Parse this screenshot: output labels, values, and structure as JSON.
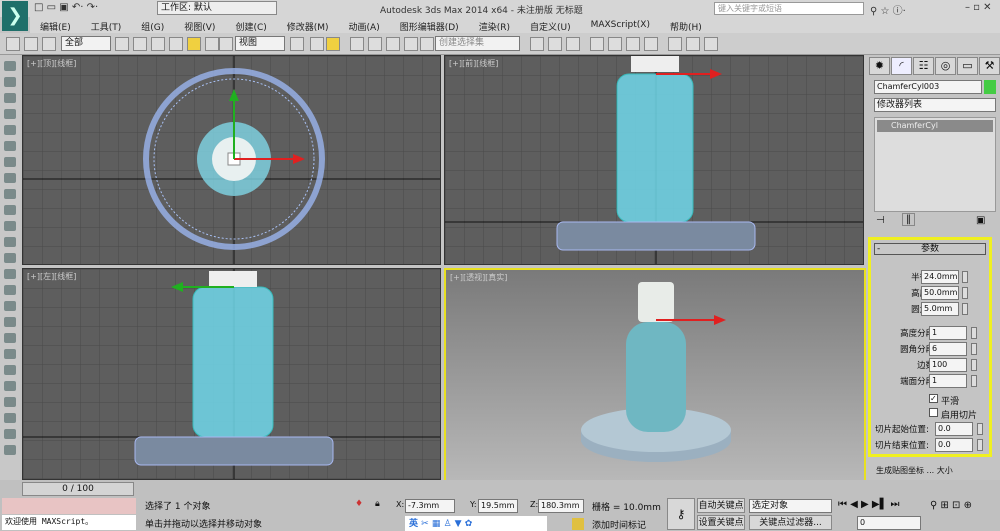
{
  "titlebar": {
    "title": "Autodesk 3ds Max  2014 x64   - 未注册版   无标题",
    "workspace": "工作区: 默认",
    "help_placeholder": "键入关键字或短语"
  },
  "menu": [
    "编辑(E)",
    "工具(T)",
    "组(G)",
    "视图(V)",
    "创建(C)",
    "修改器(M)",
    "动画(A)",
    "图形编辑器(D)",
    "渲染(R)",
    "自定义(U)",
    "MAXScript(X)",
    "帮助(H)"
  ],
  "toolbar": {
    "filter": "全部",
    "ref_coord": "视图",
    "named_selection": "创建选择集"
  },
  "viewports": [
    {
      "label": "[+][顶][线框]"
    },
    {
      "label": "[+][前][线框]"
    },
    {
      "label": "[+][左][线框]"
    },
    {
      "label": "[+][透视][真实]"
    }
  ],
  "command_panel": {
    "object_name": "ChamferCyl003",
    "object_color": "#44cc44",
    "modifier_list": "修改器列表",
    "stack_item": "ChamferCyl",
    "rollout_title": "参数",
    "params": [
      {
        "label": "半径:",
        "value": "24.0mm"
      },
      {
        "label": "高度:",
        "value": "50.0mm"
      },
      {
        "label": "圆角:",
        "value": "5.0mm"
      }
    ],
    "segments": [
      {
        "label": "高度分段:",
        "value": "1"
      },
      {
        "label": "圆角分段:",
        "value": "6"
      },
      {
        "label": "边数:",
        "value": "100"
      },
      {
        "label": "端面分段:",
        "value": "1"
      }
    ],
    "smooth_label": "平滑",
    "smooth_checked": true,
    "slice_label": "启用切片",
    "slice_checked": false,
    "slice_from_label": "切片起始位置:",
    "slice_from": "0.0",
    "slice_to_label": "切片结束位置:",
    "slice_to": "0.0",
    "extra_label": "生成贴图坐标 ... 大小"
  },
  "status": {
    "timeline": "0 / 100",
    "maxscript": "欢迎使用 MAXScript。",
    "selected": "选择了 1 个对象",
    "prompt": "单击并拖动以选择并移动对象",
    "x": "-7.3mm",
    "y": "19.5mm",
    "z": "180.3mm",
    "grid": "栅格 = 10.0mm",
    "auto_key": "自动关键点",
    "set_key": "设置关键点",
    "selected_obj": "选定对象",
    "key_filter": "关键点过滤器...",
    "add_time_tag": "添加时间标记",
    "frame": "0",
    "ime": "英"
  }
}
